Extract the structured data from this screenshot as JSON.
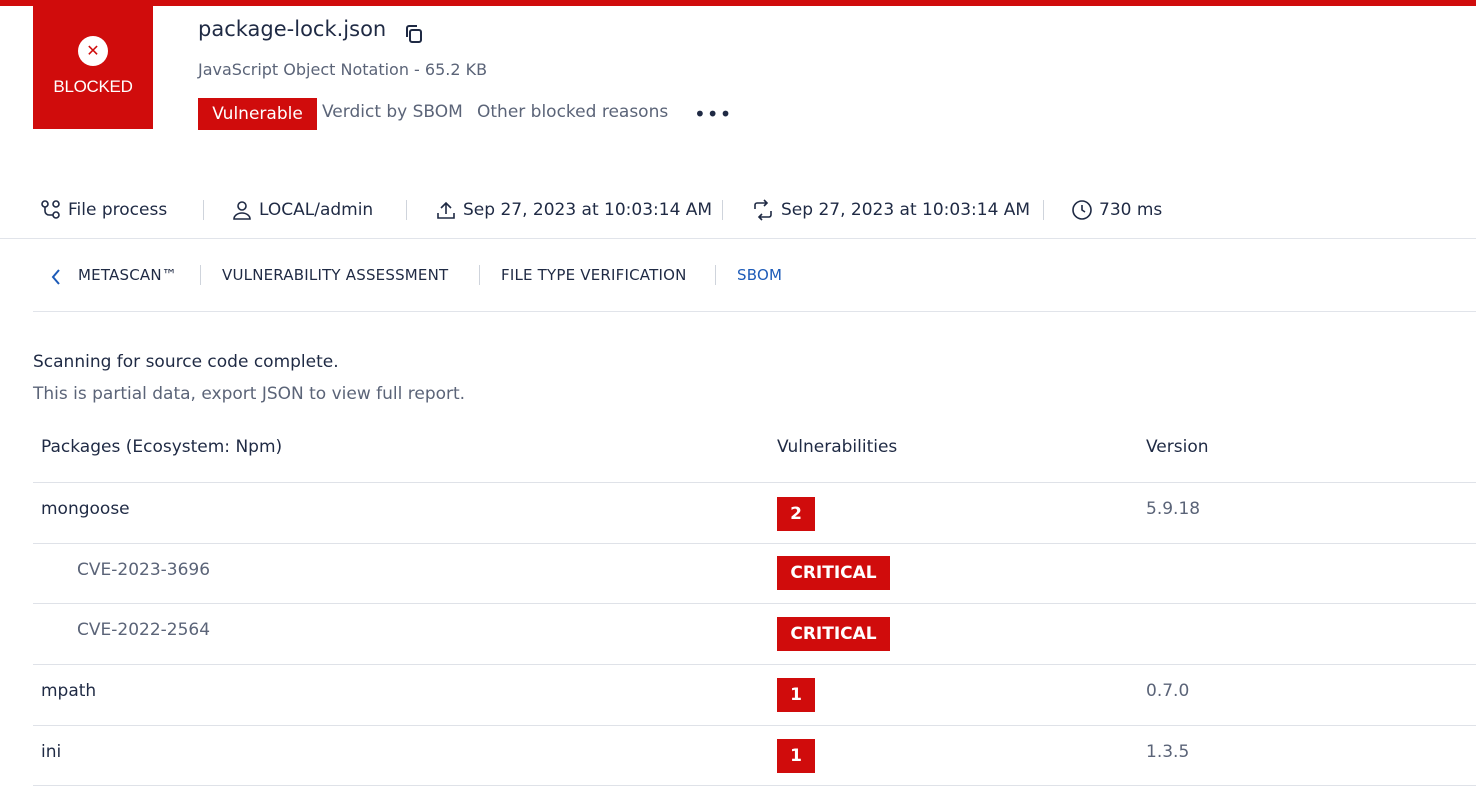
{
  "colors": {
    "accent_red": "#d00c0c",
    "tab_active": "#1d5bb8",
    "text": "#1f2a44",
    "muted": "#5b6478"
  },
  "verdict": {
    "label": "BLOCKED",
    "icon": "close-icon"
  },
  "file": {
    "name": "package-lock.json",
    "meta": "JavaScript Object Notation - 65.2 KB",
    "badge": "Vulnerable",
    "verdict_by": "Verdict by SBOM",
    "other_reasons": "Other blocked reasons",
    "more": "•••"
  },
  "info": {
    "process": "File process",
    "user": "LOCAL/admin",
    "uploaded": "Sep 27, 2023 at 10:03:14 AM",
    "processed": "Sep 27, 2023 at 10:03:14 AM",
    "duration": "730 ms"
  },
  "tabs": [
    "METASCAN™",
    "VULNERABILITY ASSESSMENT",
    "FILE TYPE VERIFICATION",
    "SBOM"
  ],
  "scan": {
    "title": "Scanning for source code complete.",
    "subtitle": "This is partial data, export JSON to view full report."
  },
  "table": {
    "headers": [
      "Packages (Ecosystem: Npm)",
      "Vulnerabilities",
      "Version"
    ],
    "rows": [
      {
        "name": "mongoose",
        "vuln": "2",
        "version": "5.9.18"
      },
      {
        "name": "CVE-2023-3696",
        "vuln": "CRITICAL",
        "version": ""
      },
      {
        "name": "CVE-2022-2564",
        "vuln": "CRITICAL",
        "version": ""
      },
      {
        "name": "mpath",
        "vuln": "1",
        "version": "0.7.0"
      },
      {
        "name": "ini",
        "vuln": "1",
        "version": "1.3.5"
      }
    ]
  }
}
